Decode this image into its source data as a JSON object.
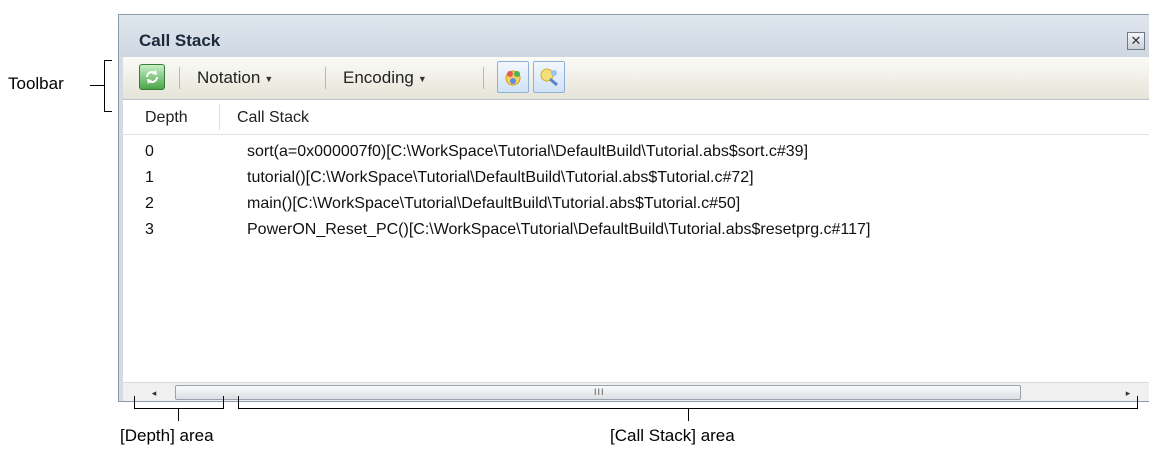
{
  "annotations": {
    "toolbar": "Toolbar",
    "depth_area": "[Depth] area",
    "callstack_area": "[Call Stack] area"
  },
  "panel": {
    "title": "Call Stack",
    "close_icon": "close-icon"
  },
  "toolbar": {
    "refresh_icon": "refresh-icon",
    "notation_label": "Notation",
    "encoding_label": "Encoding",
    "buttons": [
      "jump-to-source-icon",
      "jump-to-disassemble-icon"
    ]
  },
  "table": {
    "headers": [
      "Depth",
      "Call Stack"
    ],
    "rows": [
      {
        "depth": "0",
        "call": "sort(a=0x000007f0)[C:\\WorkSpace\\Tutorial\\DefaultBuild\\Tutorial.abs$sort.c#39]"
      },
      {
        "depth": "1",
        "call": "tutorial()[C:\\WorkSpace\\Tutorial\\DefaultBuild\\Tutorial.abs$Tutorial.c#72]"
      },
      {
        "depth": "2",
        "call": "main()[C:\\WorkSpace\\Tutorial\\DefaultBuild\\Tutorial.abs$Tutorial.c#50]"
      },
      {
        "depth": "3",
        "call": "PowerON_Reset_PC()[C:\\WorkSpace\\Tutorial\\DefaultBuild\\Tutorial.abs$resetprg.c#117]"
      }
    ]
  },
  "scrollbar": {
    "left_arrow": "◂",
    "right_arrow": "▸",
    "grip": "III"
  }
}
